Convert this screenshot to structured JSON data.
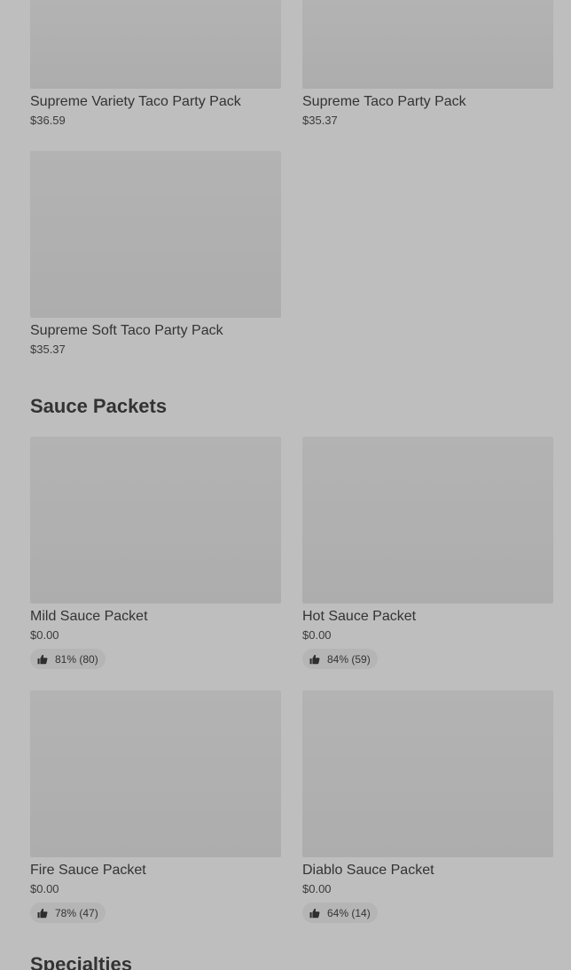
{
  "party_packs": [
    {
      "name": "Supreme Variety Taco Party Pack",
      "price": "$36.59"
    },
    {
      "name": "Supreme Taco Party Pack",
      "price": "$35.37"
    },
    {
      "name": "Supreme Soft Taco Party Pack",
      "price": "$35.37"
    }
  ],
  "sauce_section": {
    "title": "Sauce Packets",
    "items": [
      {
        "name": "Mild Sauce Packet",
        "price": "$0.00",
        "rating": "81% (80)"
      },
      {
        "name": "Hot Sauce Packet",
        "price": "$0.00",
        "rating": "84% (59)"
      },
      {
        "name": "Fire Sauce Packet",
        "price": "$0.00",
        "rating": "78% (47)"
      },
      {
        "name": "Diablo Sauce Packet",
        "price": "$0.00",
        "rating": "64% (14)"
      }
    ]
  },
  "specialties_section": {
    "title": "Specialties"
  },
  "icons": {
    "rating": "thumbs-up-icon"
  },
  "colors": {
    "background": "#bebebe",
    "image_placeholder": "#b0b0b0",
    "text": "#333333",
    "rating_pill": "#b5b5b5"
  }
}
